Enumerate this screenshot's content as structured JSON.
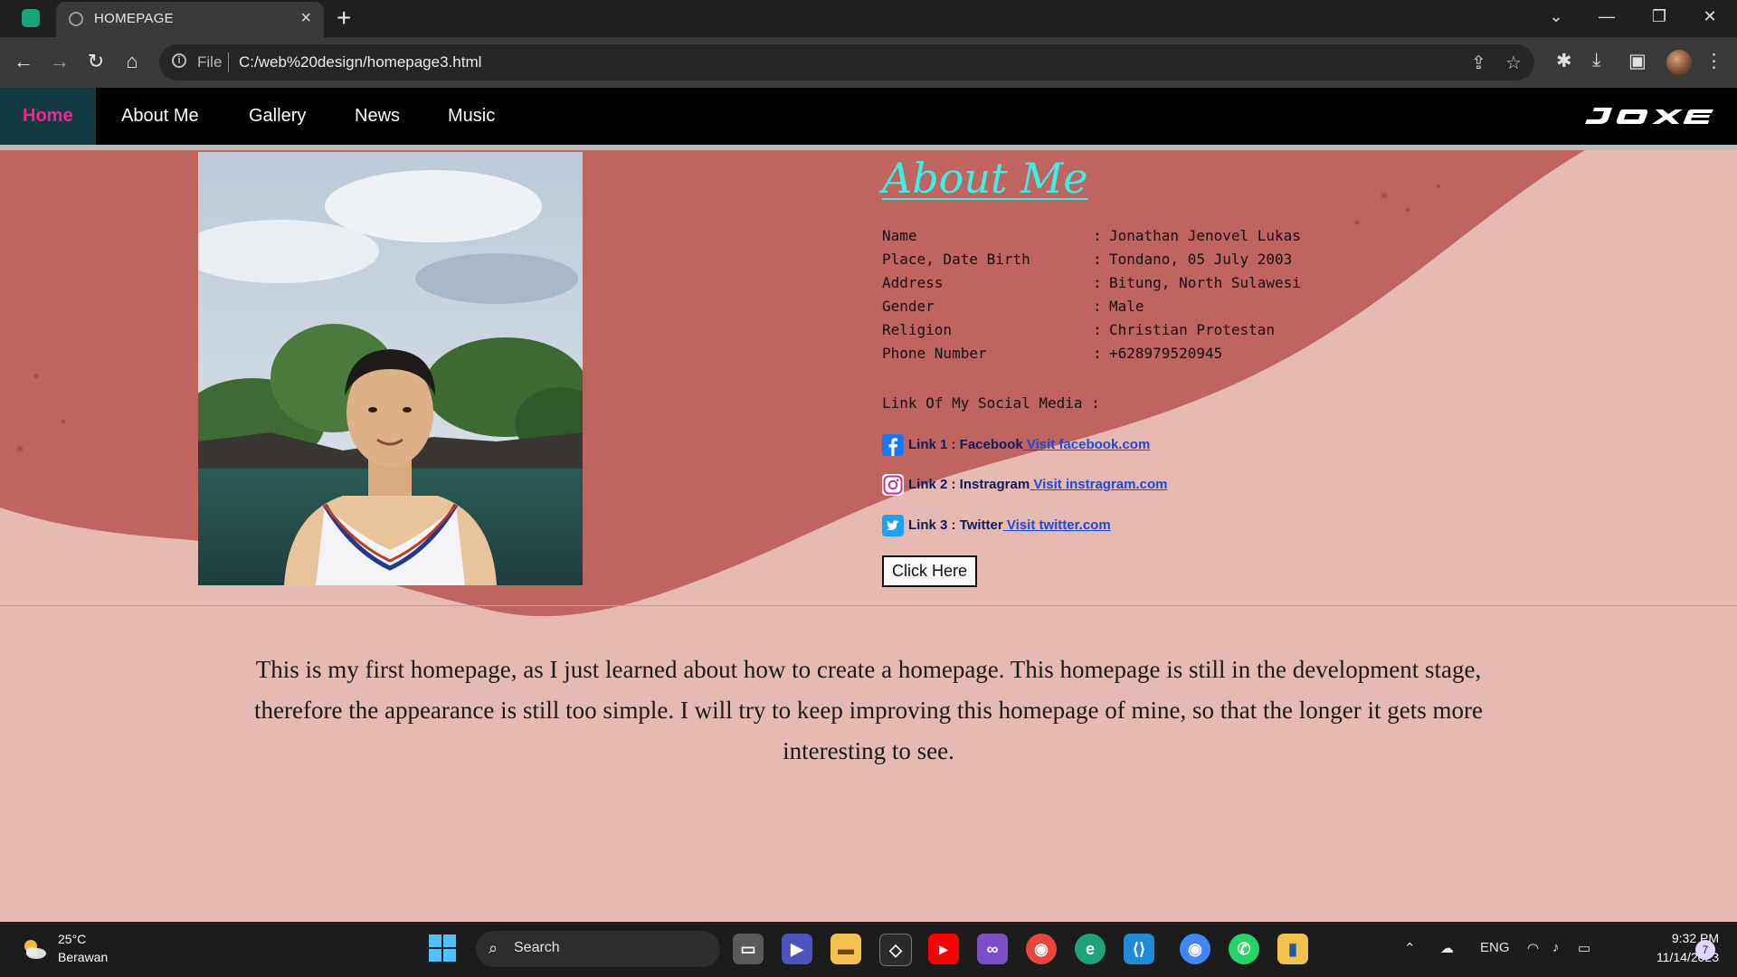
{
  "browser": {
    "tab_title": "HOMEPAGE",
    "scheme_label": "File",
    "url": "C:/web%20design/homepage3.html"
  },
  "site_nav": {
    "items": [
      {
        "label": "Home",
        "active": true
      },
      {
        "label": "About Me"
      },
      {
        "label": "Gallery"
      },
      {
        "label": "News"
      },
      {
        "label": "Music"
      }
    ],
    "logo_text": "JOXE"
  },
  "about": {
    "title": "About Me",
    "fields": [
      {
        "key": "Name",
        "value": "Jonathan Jenovel Lukas"
      },
      {
        "key": "Place, Date Birth",
        "value": "Tondano, 05 July 2003"
      },
      {
        "key": "Address",
        "value": "Bitung, North Sulawesi"
      },
      {
        "key": "Gender",
        "value": "Male"
      },
      {
        "key": "Religion",
        "value": "Christian Protestan"
      },
      {
        "key": "Phone Number",
        "value": "+628979520945"
      }
    ],
    "colon": ":",
    "social_heading": "Link Of My Social Media :",
    "links": [
      {
        "label": "Link 1 : Facebook",
        "link_text": " Visit facebook.com",
        "icon": "facebook-icon"
      },
      {
        "label": "Link 2 : Instragram",
        "link_text": " Visit instragram.com",
        "icon": "instagram-icon"
      },
      {
        "label": "Link 3 : Twitter",
        "link_text": " Visit twitter.com",
        "icon": "twitter-icon"
      }
    ],
    "button_label": "Click Here"
  },
  "intro_text": "This is my first homepage, as I just learned about how to create a homepage. This homepage is still in the development stage, therefore the appearance is still too simple. I will try to keep improving this homepage of mine, so that the longer it gets more interesting to see.",
  "taskbar": {
    "weather_temp": "25°C",
    "weather_desc": "Berawan",
    "search_label": "Search",
    "language": "ENG",
    "time": "9:32 PM",
    "date": "11/14/2023",
    "notification_count": "7"
  },
  "colors": {
    "nav_active_text": "#ff1f8e",
    "nav_active_bg": "#103a40",
    "about_title": "#39f0e6",
    "page_background": "#e7b9b3",
    "wave": "#c0645f",
    "link": "#1b4ad8"
  }
}
